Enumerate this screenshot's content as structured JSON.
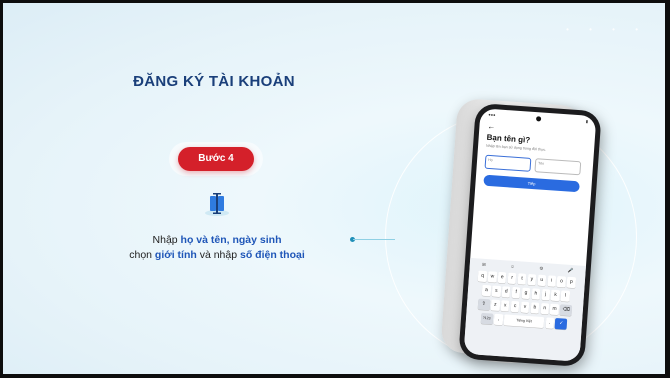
{
  "slide": {
    "title": "ĐĂNG KÝ TÀI KHOẢN",
    "step_label": "Bước 4",
    "desc_line1_pre": "Nhập ",
    "desc_line1_bold": "họ và tên, ngày sinh",
    "desc_line2_pre": "chọn ",
    "desc_line2_bold1": "giới tính",
    "desc_line2_mid": " và nhập ",
    "desc_line2_bold2": "số điện thoại",
    "accent_red": "#d4202a",
    "accent_blue": "#1f56b8",
    "title_color": "#1a3f7a"
  },
  "phone": {
    "back_arrow": "←",
    "question": "Bạn tên gì?",
    "hint": "Nhập tên bạn sử dụng trong đời thực.",
    "first_name_placeholder": "Họ",
    "last_name_placeholder": "Tên",
    "next_button": "Tiếp",
    "keyboard": {
      "row1": [
        "q",
        "w",
        "e",
        "r",
        "t",
        "y",
        "u",
        "i",
        "o",
        "p"
      ],
      "row2": [
        "a",
        "s",
        "d",
        "f",
        "g",
        "h",
        "j",
        "k",
        "l"
      ],
      "row3": [
        "z",
        "x",
        "c",
        "v",
        "b",
        "n",
        "m"
      ],
      "space_label": "Tiếng Việt",
      "symbols_key": "?123"
    }
  }
}
